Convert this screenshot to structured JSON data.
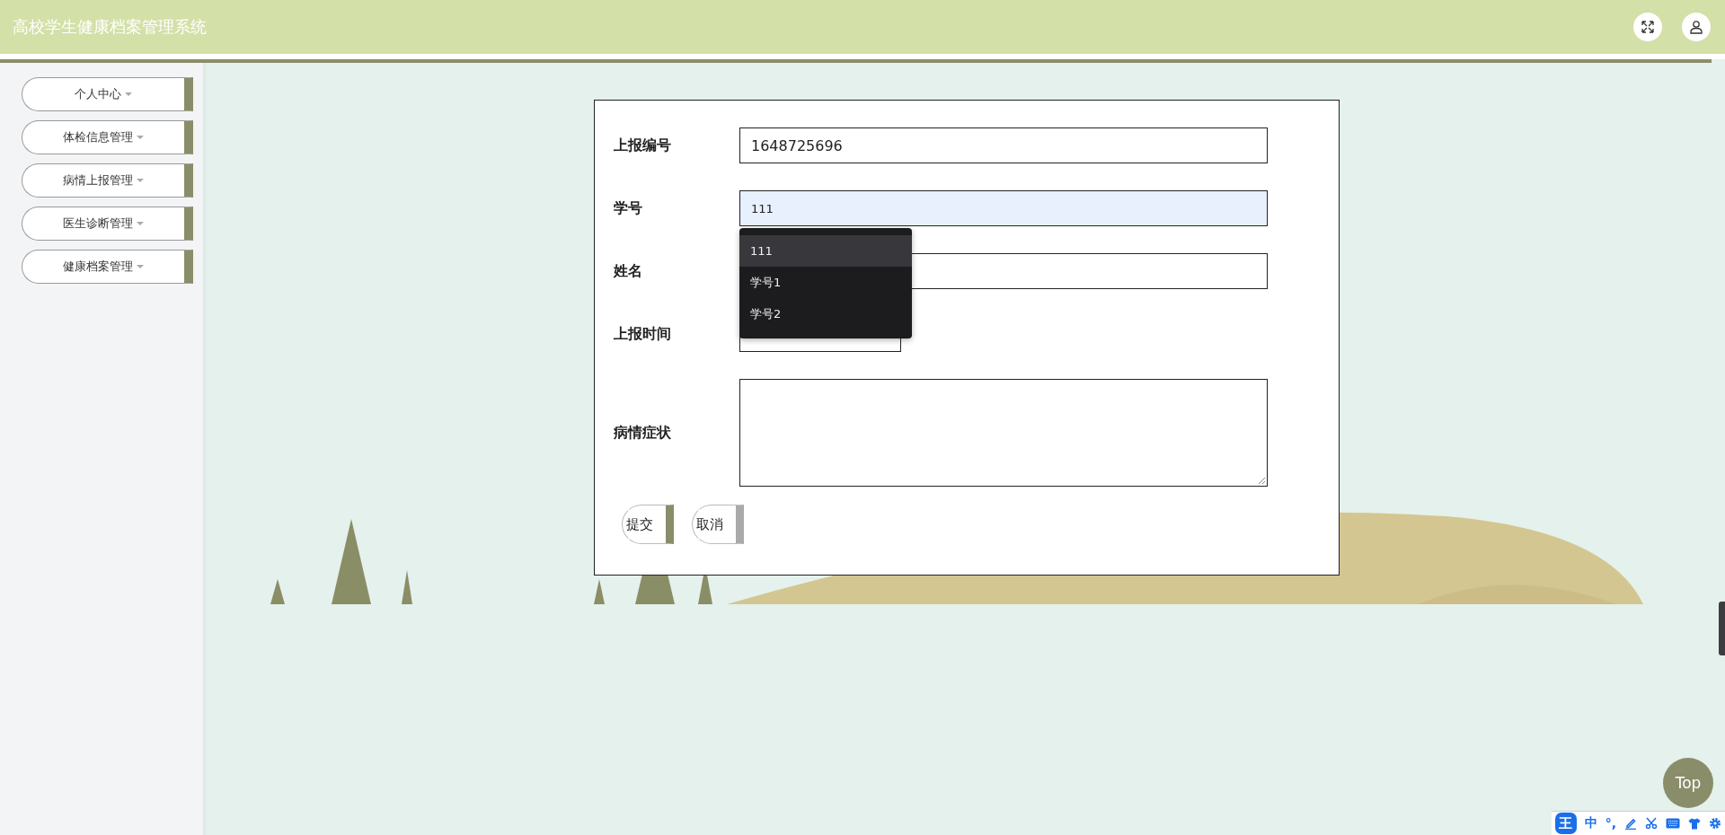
{
  "header": {
    "title": "高校学生健康档案管理系统"
  },
  "sidebar": {
    "items": [
      {
        "label": "个人中心"
      },
      {
        "label": "体检信息管理"
      },
      {
        "label": "病情上报管理"
      },
      {
        "label": "医生诊断管理"
      },
      {
        "label": "健康档案管理"
      }
    ]
  },
  "form": {
    "fields": [
      {
        "kind": "input",
        "label": "上报编号",
        "value": "1648725696",
        "focused": false
      },
      {
        "kind": "input",
        "label": "学号",
        "value": "111",
        "focused": true
      },
      {
        "kind": "input",
        "label": "姓名",
        "focused": false
      },
      {
        "kind": "date",
        "label": "上报时间",
        "focused": false
      },
      {
        "kind": "textarea",
        "label": "病情症状",
        "focused": false
      }
    ],
    "suggestions": [
      {
        "label": "111",
        "selected": true
      },
      {
        "label": "学号1",
        "selected": false
      },
      {
        "label": "学号2",
        "selected": false
      }
    ],
    "buttons": [
      {
        "label": "提交",
        "kind": "primary"
      },
      {
        "label": "取消",
        "kind": "secondary"
      }
    ]
  },
  "top_button": {
    "label": "Top"
  },
  "ime_toolbar": {
    "logo": "王",
    "mode": "中",
    "punctuation": "°,"
  }
}
